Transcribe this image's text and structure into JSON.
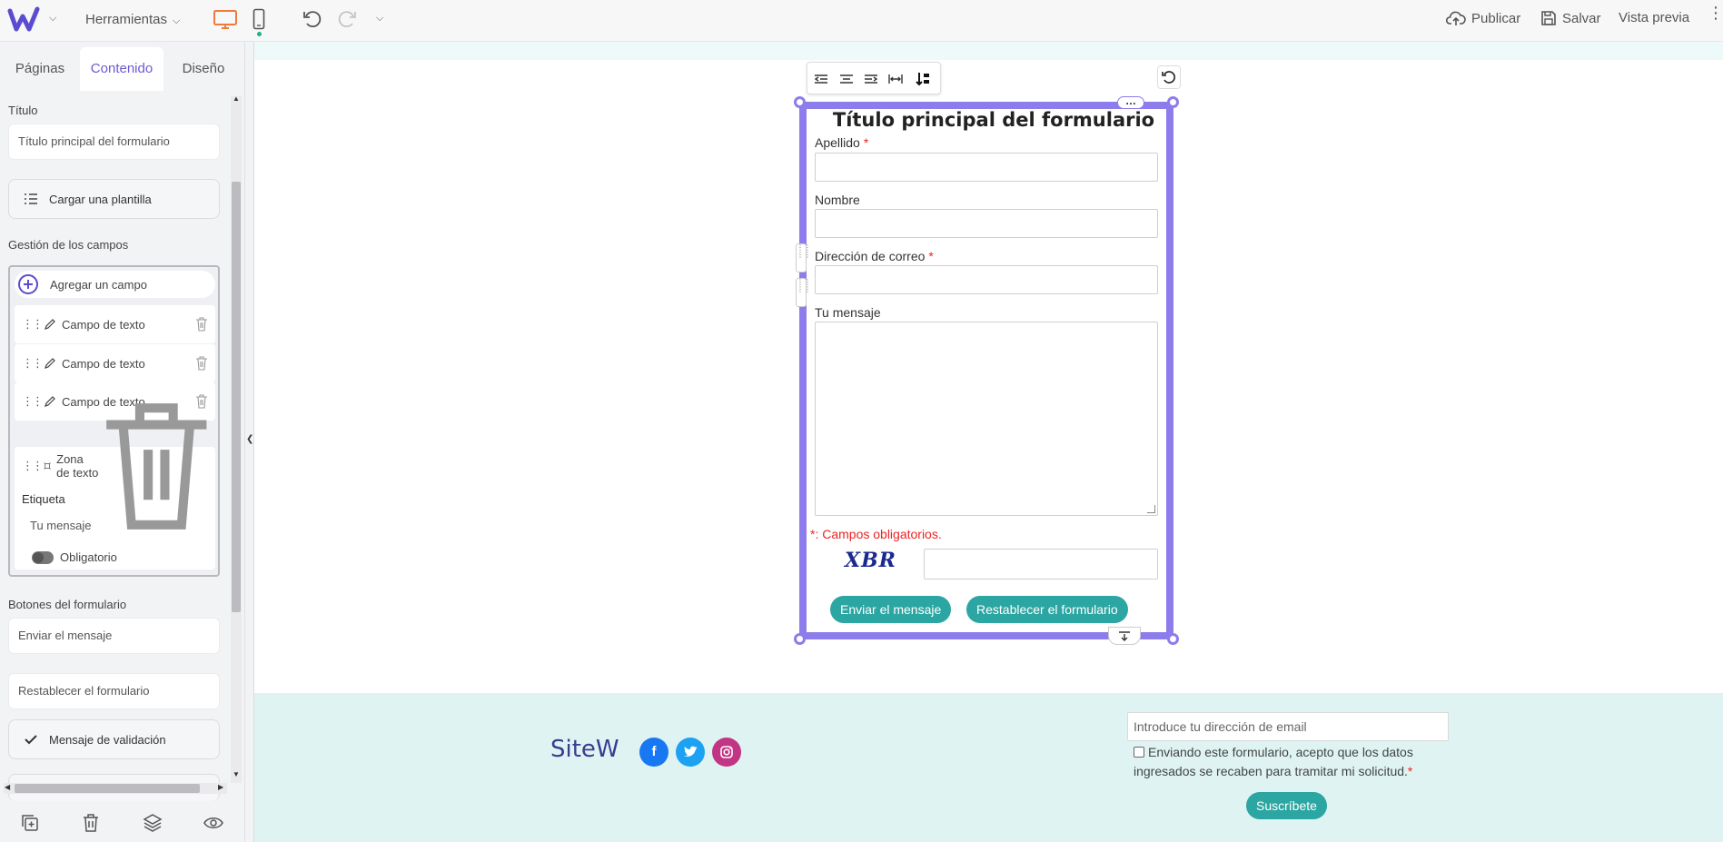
{
  "topbar": {
    "tools_label": "Herramientas",
    "publish_label": "Publicar",
    "save_label": "Salvar",
    "preview_label": "Vista previa"
  },
  "panel": {
    "tabs": [
      {
        "label": "Páginas"
      },
      {
        "label": "Contenido"
      },
      {
        "label": "Diseño"
      }
    ],
    "title_label": "Título",
    "title_value": "Título principal del formulario",
    "load_template_label": "Cargar una plantilla",
    "fields_management_label": "Gestión de los campos",
    "add_field_label": "Agregar un campo",
    "fields": [
      {
        "label": "Campo de texto"
      },
      {
        "label": "Campo de texto"
      },
      {
        "label": "Campo de texto"
      },
      {
        "label": "Zona de texto"
      }
    ],
    "open_field": {
      "tag_label": "Etiqueta",
      "tag_value": "Tu mensaje",
      "required_label": "Obligatorio"
    },
    "form_buttons_label": "Botones del formulario",
    "send_value": "Enviar el mensaje",
    "reset_value": "Restablecer el formulario",
    "validation_label": "Mensaje de validación"
  },
  "form": {
    "title": "Título principal del formulario",
    "fields": [
      {
        "label": "Apellido",
        "required_mark": "*"
      },
      {
        "label": "Nombre",
        "required_mark": ""
      },
      {
        "label": "Dirección de correo",
        "required_mark": "*"
      },
      {
        "label": "Tu mensaje",
        "required_mark": ""
      }
    ],
    "required_note": "*: Campos obligatorios.",
    "captcha_text": "XBR",
    "send_button": "Enviar el mensaje",
    "reset_button": "Restablecer el formulario"
  },
  "footer": {
    "brand": "SiteW",
    "social": [
      "f",
      "t",
      "ig"
    ],
    "email_placeholder": "Introduce tu dirección de email",
    "consent_text": "Enviando este formulario, acepto que los datos ingresados se recaben para tramitar mi solicitud.",
    "consent_required_mark": "*",
    "subscribe_button": "Suscríbete"
  },
  "colors": {
    "accent": "#8d7cec",
    "tab_active": "#6b5bd6",
    "teal": "#2ca6a2",
    "required": "#e22222",
    "desktop_icon": "#f07a3c",
    "footer_bg": "#dff3f3"
  }
}
